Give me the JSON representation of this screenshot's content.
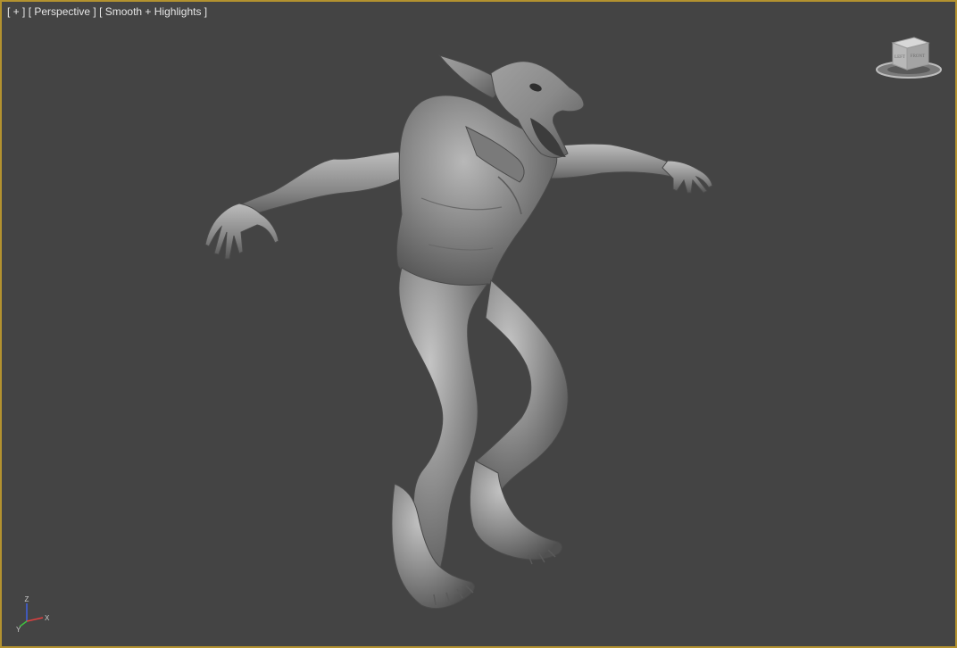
{
  "viewport": {
    "menu_plus": "[ + ]",
    "menu_view": "[ Perspective ]",
    "menu_shading": "[ Smooth + Highlights ]",
    "border_color": "#b3922f",
    "background_color": "#444444"
  },
  "viewcube": {
    "icon": "viewcube-icon",
    "face_left": "LEFT",
    "face_front": "FRONT"
  },
  "axis_tripod": {
    "icon": "axis-tripod-icon",
    "z_label": "Z",
    "x_label": "X",
    "y_label": "Y",
    "colors": {
      "x": "#e04040",
      "y": "#40c040",
      "z": "#4060e0"
    }
  },
  "scene": {
    "object": "creature-model"
  }
}
